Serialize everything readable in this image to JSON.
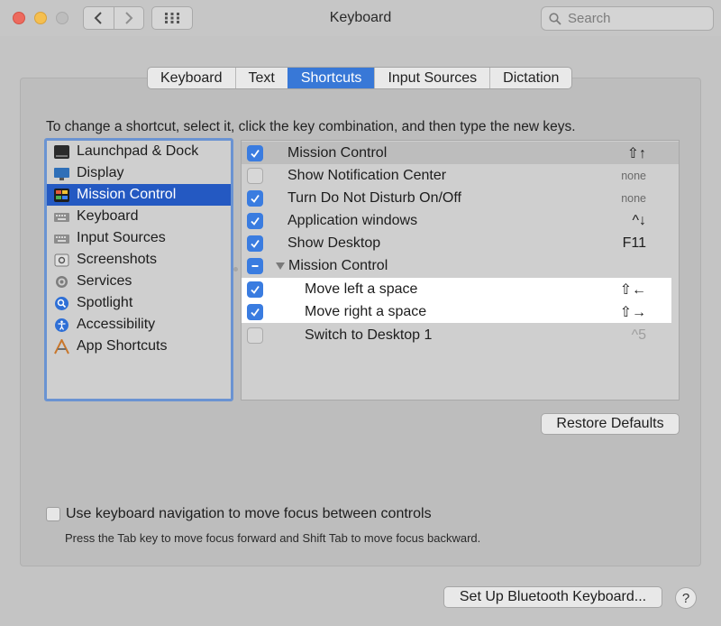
{
  "window": {
    "title": "Keyboard"
  },
  "search": {
    "placeholder": "Search"
  },
  "tabs": [
    {
      "label": "Keyboard",
      "active": false
    },
    {
      "label": "Text",
      "active": false
    },
    {
      "label": "Shortcuts",
      "active": true
    },
    {
      "label": "Input Sources",
      "active": false
    },
    {
      "label": "Dictation",
      "active": false
    }
  ],
  "instruction": "To change a shortcut, select it, click the key combination, and then type the new keys.",
  "categories": [
    {
      "label": "Launchpad & Dock",
      "icon": "launchpad-icon"
    },
    {
      "label": "Display",
      "icon": "display-icon"
    },
    {
      "label": "Mission Control",
      "icon": "mission-control-icon",
      "selected": true
    },
    {
      "label": "Keyboard",
      "icon": "keyboard-icon"
    },
    {
      "label": "Input Sources",
      "icon": "input-sources-icon"
    },
    {
      "label": "Screenshots",
      "icon": "screenshots-icon"
    },
    {
      "label": "Services",
      "icon": "gear-icon"
    },
    {
      "label": "Spotlight",
      "icon": "spotlight-icon"
    },
    {
      "label": "Accessibility",
      "icon": "accessibility-icon"
    },
    {
      "label": "App Shortcuts",
      "icon": "app-shortcuts-icon"
    }
  ],
  "shortcuts": [
    {
      "label": "Mission Control",
      "checked": "on",
      "keys": "⇧↑"
    },
    {
      "label": "Show Notification Center",
      "checked": "off",
      "keys": "none"
    },
    {
      "label": "Turn Do Not Disturb On/Off",
      "checked": "on",
      "keys": "none"
    },
    {
      "label": "Application windows",
      "checked": "on",
      "keys": "^↓"
    },
    {
      "label": "Show Desktop",
      "checked": "on",
      "keys": "F11"
    },
    {
      "label": "Mission Control",
      "checked": "mixed",
      "keys": ""
    },
    {
      "label": "Move left a space",
      "checked": "on",
      "keys": "⇧←"
    },
    {
      "label": "Move right a space",
      "checked": "on",
      "keys": "⇧→"
    },
    {
      "label": "Switch to Desktop 1",
      "checked": "off",
      "keys": "^5"
    }
  ],
  "buttons": {
    "restore": "Restore Defaults",
    "bluetooth": "Set Up Bluetooth Keyboard...",
    "help": "?"
  },
  "keyboard_nav": {
    "label": "Use keyboard navigation to move focus between controls",
    "checked": false,
    "hint": "Press the Tab key to move focus forward and Shift Tab to move focus backward."
  },
  "colors": {
    "accent": "#3878d7",
    "selection": "#2459c2"
  }
}
